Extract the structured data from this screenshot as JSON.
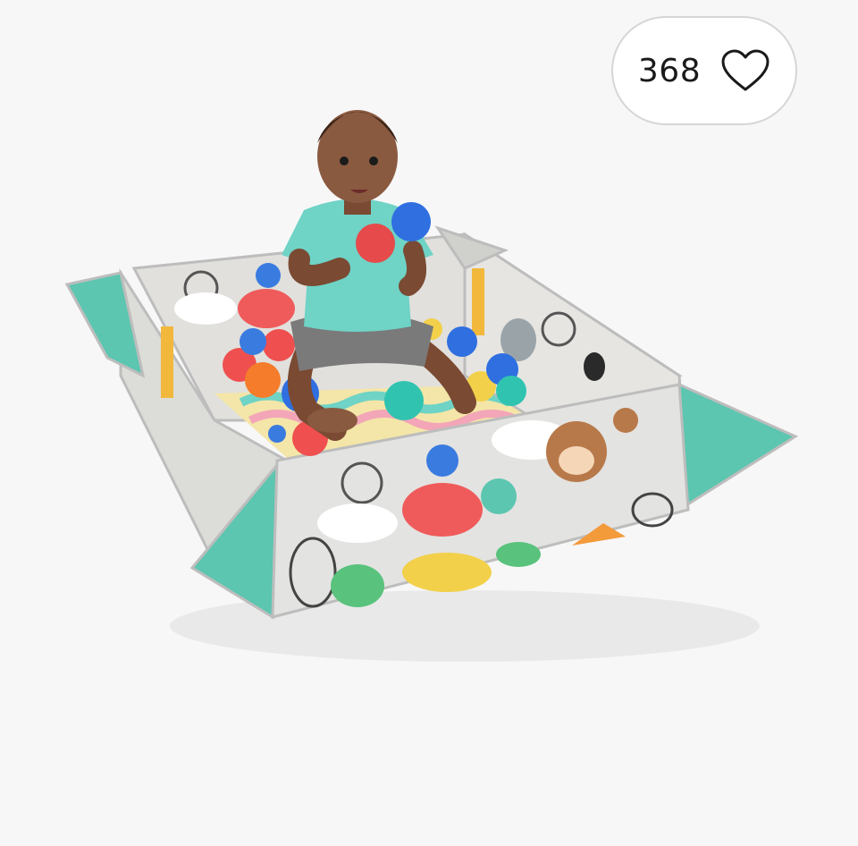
{
  "like_button": {
    "count": "368",
    "icon": "heart-outline-icon",
    "color": "#1a1a1a"
  },
  "product_image": {
    "description_icon": "baby-playmat-ball-pit-image",
    "colors": {
      "mat_gray": "#e3e3e1",
      "corner_teal": "#5cc6b0",
      "shirt_teal": "#6fd3c6",
      "shorts_gray": "#7a7a7a"
    }
  }
}
